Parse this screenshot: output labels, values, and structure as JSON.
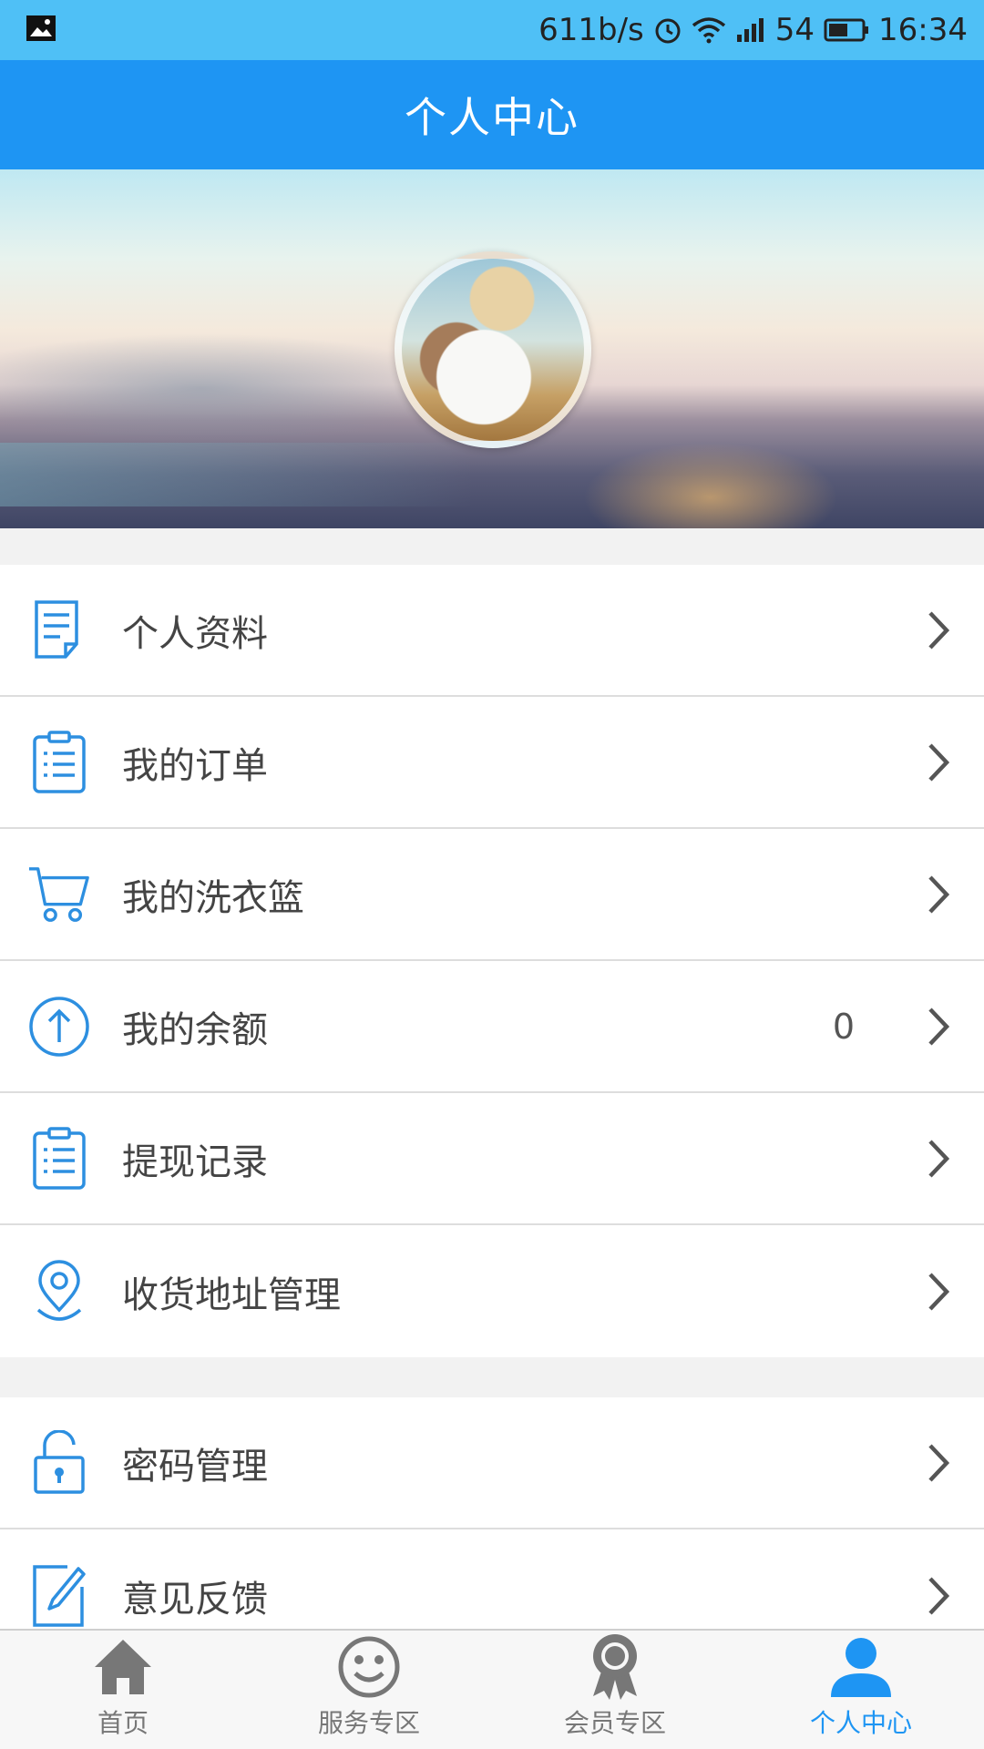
{
  "status_bar": {
    "speed": "611b/s",
    "battery": "54",
    "time": "16:34",
    "icons": [
      "image-icon",
      "alarm-icon",
      "wifi-icon",
      "signal-icon",
      "battery-icon"
    ]
  },
  "header": {
    "title": "个人中心"
  },
  "menu_group_1": [
    {
      "label": "个人资料",
      "icon": "profile-doc-icon"
    },
    {
      "label": "我的订单",
      "icon": "order-list-icon"
    },
    {
      "label": "我的洗衣篮",
      "icon": "cart-icon"
    },
    {
      "label": "我的余额",
      "icon": "balance-up-icon",
      "value": "0"
    },
    {
      "label": "提现记录",
      "icon": "withdraw-list-icon"
    },
    {
      "label": "收货地址管理",
      "icon": "location-pin-icon"
    }
  ],
  "menu_group_2": [
    {
      "label": "密码管理",
      "icon": "lock-icon"
    },
    {
      "label": "意见反馈",
      "icon": "edit-icon"
    }
  ],
  "bottom_nav": [
    {
      "label": "首页",
      "icon": "home-icon"
    },
    {
      "label": "服务专区",
      "icon": "smiley-icon"
    },
    {
      "label": "会员专区",
      "icon": "medal-icon"
    },
    {
      "label": "个人中心",
      "icon": "person-icon",
      "active": true
    }
  ],
  "colors": {
    "primary": "#1e95f3",
    "status_bar": "#4fc0f6",
    "icon_blue": "#2d8fe0"
  }
}
